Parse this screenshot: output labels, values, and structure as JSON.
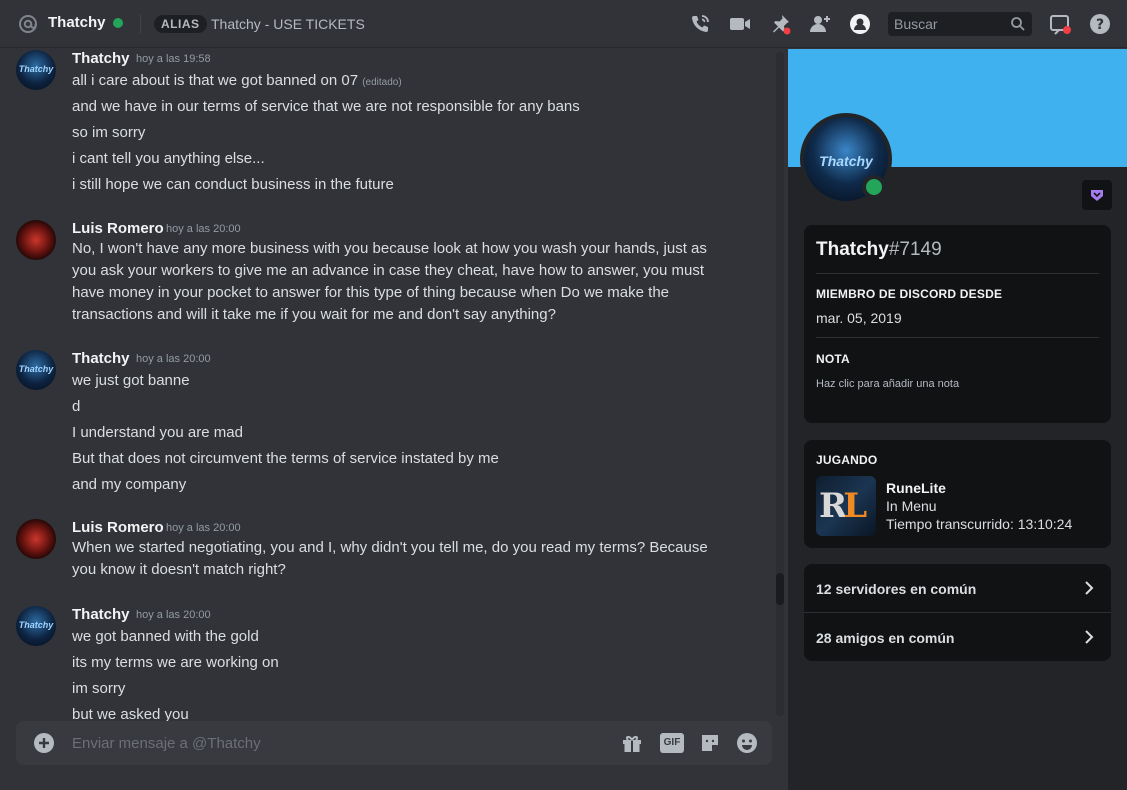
{
  "header": {
    "dm_name": "Thatchy",
    "alias_badge": "ALIAS",
    "alias_text": "Thatchy - USE TICKETS",
    "search_placeholder": "Buscar",
    "status_color": "#23a55a",
    "icons": [
      "at-icon",
      "voice-call-icon",
      "video-call-icon",
      "pin-icon",
      "add-friends-icon",
      "user-profile-icon",
      "search-icon",
      "inbox-icon",
      "help-icon"
    ]
  },
  "messages": [
    {
      "author": "Thatchy",
      "timestamp": "hoy a las 19:58",
      "lines": [
        {
          "text": "all i care about is that we got banned on 07",
          "edited": "(editado)"
        },
        {
          "text": "and we have in our terms of service that we are not responsible for any bans"
        },
        {
          "text": "so im sorry"
        },
        {
          "text": "i cant tell you anything else..."
        },
        {
          "text": "i still hope we can conduct business in the future"
        }
      ]
    },
    {
      "author": "Luis Romero",
      "timestamp": "hoy a las 20:00",
      "lines": [
        {
          "text": "No, I won't have any more business with you because look at how you wash your hands, just as you ask your workers to give me an advance in case they cheat, have how to answer, you must have money in your pocket to answer for this type of thing because when Do we make the transactions and will it take me if you wait for me and don't say anything?"
        }
      ]
    },
    {
      "author": "Thatchy",
      "timestamp": "hoy a las 20:00",
      "lines": [
        {
          "text": "we just got banne"
        },
        {
          "text": "d"
        },
        {
          "text": "I understand you are mad"
        },
        {
          "text": "But that does not circumvent the terms of service instated by me"
        },
        {
          "text": "and my company"
        }
      ]
    },
    {
      "author": "Luis Romero",
      "timestamp": "hoy a las 20:00",
      "lines": [
        {
          "text": "When we started negotiating, you and I, why didn't you tell me, do you read my terms? Because you know it doesn't match right?"
        }
      ]
    },
    {
      "author": "Thatchy",
      "timestamp": "hoy a las 20:00",
      "lines": [
        {
          "text": "we got banned with the gold"
        },
        {
          "text": "its my terms we are working on"
        },
        {
          "text": "im sorry"
        },
        {
          "text": "but we asked you"
        }
      ]
    }
  ],
  "composer": {
    "placeholder": "Enviar mensaje a @Thatchy",
    "gif_label": "GIF",
    "icons": [
      "add-attachment-icon",
      "gift-icon",
      "gif-icon",
      "sticker-icon",
      "emoji-icon"
    ]
  },
  "profile": {
    "banner_color": "#3fb1ef",
    "avatar_text": "Thatchy",
    "username": "Thatchy",
    "discriminator": "#7149",
    "member_since_title": "MIEMBRO DE DISCORD DESDE",
    "member_since": "mar. 05, 2019",
    "note_title": "NOTA",
    "note_placeholder": "Haz clic para añadir una nota",
    "playing_title": "JUGANDO",
    "game_name": "RuneLite",
    "game_state": "In Menu",
    "game_elapsed": "Tiempo transcurrido: 13:10:24",
    "mutual_servers": "12 servidores en común",
    "mutual_friends": "28 amigos en común"
  }
}
